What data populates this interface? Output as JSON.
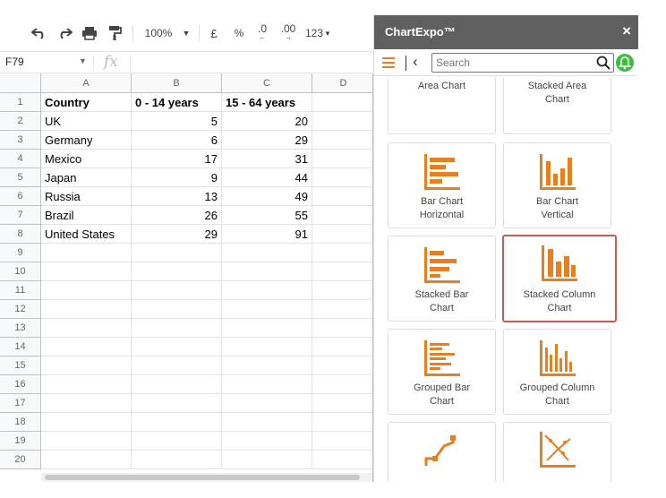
{
  "toolbar": {
    "zoom": "100%",
    "currency": "£",
    "percent": "%",
    "dec_decrease": ".0",
    "dec_increase": ".00",
    "more_formats": "123"
  },
  "formula_bar": {
    "name_box": "F79",
    "fx_label": "fx"
  },
  "sheet": {
    "columns": [
      "A",
      "B",
      "C",
      "D"
    ],
    "rows": [
      "1",
      "2",
      "3",
      "4",
      "5",
      "6",
      "7",
      "8",
      "9",
      "10",
      "11",
      "12",
      "13",
      "14",
      "15",
      "16",
      "17",
      "18",
      "19",
      "20"
    ],
    "header_row": [
      "Country",
      "0 - 14 years",
      "15 - 64 years"
    ],
    "data": [
      [
        "UK",
        "5",
        "20"
      ],
      [
        "Germany",
        "6",
        "29"
      ],
      [
        "Mexico",
        "17",
        "31"
      ],
      [
        "Japan",
        "9",
        "44"
      ],
      [
        "Russia",
        "13",
        "49"
      ],
      [
        "Brazil",
        "26",
        "55"
      ],
      [
        "United States",
        "29",
        "91"
      ]
    ]
  },
  "panel": {
    "title": "ChartExpo™",
    "close": "×",
    "search_placeholder": "Search",
    "accent_color": "#e67e22",
    "selected_color": "#d0574f",
    "cards": [
      {
        "label1": "Area Chart",
        "label2": "",
        "icon": "area-chart-icon"
      },
      {
        "label1": "Stacked Area",
        "label2": "Chart",
        "icon": "stacked-area-chart-icon"
      },
      {
        "label1": "Bar Chart",
        "label2": "Horizontal",
        "icon": "bar-chart-horizontal-icon"
      },
      {
        "label1": "Bar Chart",
        "label2": "Vertical",
        "icon": "bar-chart-vertical-icon"
      },
      {
        "label1": "Stacked Bar",
        "label2": "Chart",
        "icon": "stacked-bar-chart-icon"
      },
      {
        "label1": "Stacked Column",
        "label2": "Chart",
        "icon": "stacked-column-chart-icon",
        "selected": true
      },
      {
        "label1": "Grouped Bar",
        "label2": "Chart",
        "icon": "grouped-bar-chart-icon"
      },
      {
        "label1": "Grouped Column",
        "label2": "Chart",
        "icon": "grouped-column-chart-icon"
      },
      {
        "label1": "",
        "label2": "",
        "icon": "line-chart-icon"
      },
      {
        "label1": "",
        "label2": "",
        "icon": "scatter-chart-icon"
      }
    ]
  }
}
